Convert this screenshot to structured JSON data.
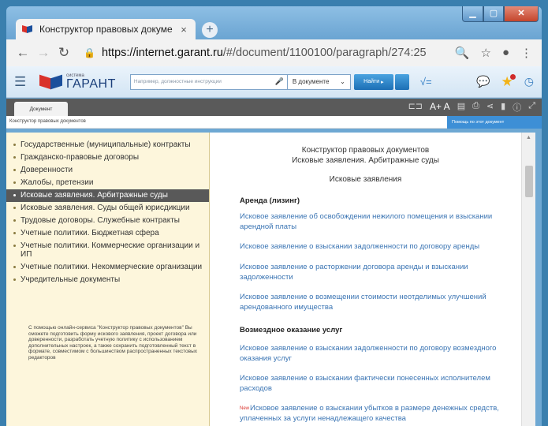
{
  "browser": {
    "tab_title": "Конструктор правовых докуме",
    "tab_close": "×",
    "new_tab": "+",
    "url_host": "https://internet.garant.ru",
    "url_path": "/#/document/1100100/paragraph/274:25"
  },
  "toolbar": {
    "logo_small": "система",
    "logo_big": "ГАРАНТ",
    "search_placeholder": "Например, должностные инструкции",
    "scope_label": "В документе",
    "find_label": "Найти"
  },
  "docstrip": {
    "tab_label": "Документ",
    "aa_label": "A+ A"
  },
  "crumb": {
    "text": "Конструктор правовых документов",
    "help_label": "Помощь по этот документ"
  },
  "sidebar": {
    "items": [
      {
        "label": "Государственные (муниципальные) контракты"
      },
      {
        "label": "Гражданско-правовые договоры"
      },
      {
        "label": "Доверенности"
      },
      {
        "label": "Жалобы, претензии"
      },
      {
        "label": "Исковые заявления. Арбитражные суды"
      },
      {
        "label": "Исковые заявления. Суды общей юрисдикции"
      },
      {
        "label": "Трудовые договоры. Служебные контракты"
      },
      {
        "label": "Учетные политики. Бюджетная сфера"
      },
      {
        "label": "Учетные политики. Коммерческие организации и ИП"
      },
      {
        "label": "Учетные политики. Некоммерческие организации"
      },
      {
        "label": "Учредительные документы"
      }
    ],
    "active_index": 4,
    "note": "С помощью онлайн-сервиса \"Конструктор правовых документов\" Вы сможете подготовить форму искового заявления, проект договора или доверенности, разработать учетную политику с использованием дополнительных настроек, а также сохранить подготовленный текст в формате, совместимом с большинством распространенных текстовых редакторов"
  },
  "document": {
    "header_line1": "Конструктор правовых документов",
    "header_line2": "Исковые заявления. Арбитражные суды",
    "subtitle": "Исковые заявления",
    "section1": "Аренда (лизинг)",
    "link1": "Исковое заявление об освобождении нежилого помещения и взыскании арендной платы",
    "link2": "Исковое заявление о взыскании задолженности по договору аренды",
    "link3": "Исковое заявление о расторжении договора аренды и взыскании задолженности",
    "link4": "Исковое заявление о возмещении стоимости неотделимых улучшений арендованного имущества",
    "section2": "Возмездное оказание услуг",
    "link5": "Исковое заявление о взыскании задолженности по договору возмездного оказания услуг",
    "link6": "Исковое заявление о взыскании фактически понесенных исполнителем расходов",
    "new_badge": "New",
    "link7": "Исковое заявление о взыскании убытков в размере денежных средств, уплаченных за услуги ненадлежащего качества"
  }
}
